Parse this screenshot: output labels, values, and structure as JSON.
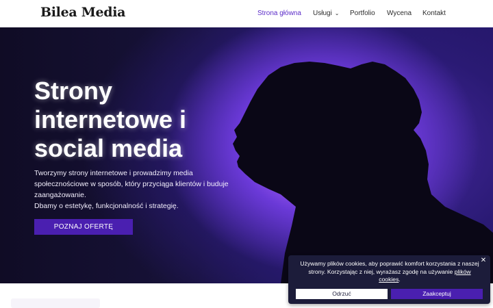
{
  "header": {
    "logo": "Bilea Media",
    "nav": [
      {
        "label": "Strona główna",
        "active": true
      },
      {
        "label": "Usługi",
        "has_dropdown": true
      },
      {
        "label": "Portfolio"
      },
      {
        "label": "Wycena"
      },
      {
        "label": "Kontakt"
      }
    ],
    "dropdown_icon": "chevron-down-icon"
  },
  "hero": {
    "title_lines": [
      "Strony",
      "internetowe i",
      "social media"
    ],
    "description_lines": [
      "Tworzymy strony internetowe i prowadzimy media",
      "społecznościowe w sposób, który przyciąga klientów i buduje",
      "zaangażowanie.",
      "Dbamy o estetykę, funkcjonalność i strategię."
    ],
    "cta_label": "POZNAJ OFERTĘ"
  },
  "cookie_banner": {
    "text": "Używamy plików cookies, aby poprawić komfort korzystania z naszej strony. Korzystając z niej, wyrażasz zgodę na używanie",
    "link_text": "plików cookies",
    "link_suffix": ".",
    "reject_label": "Odrzuć",
    "accept_label": "Zaakceptuj",
    "close_icon": "close-icon"
  },
  "colors": {
    "accent": "#5a2ac8",
    "cta_background": "#4a1fb0",
    "cookie_background": "#1c1c3a"
  }
}
